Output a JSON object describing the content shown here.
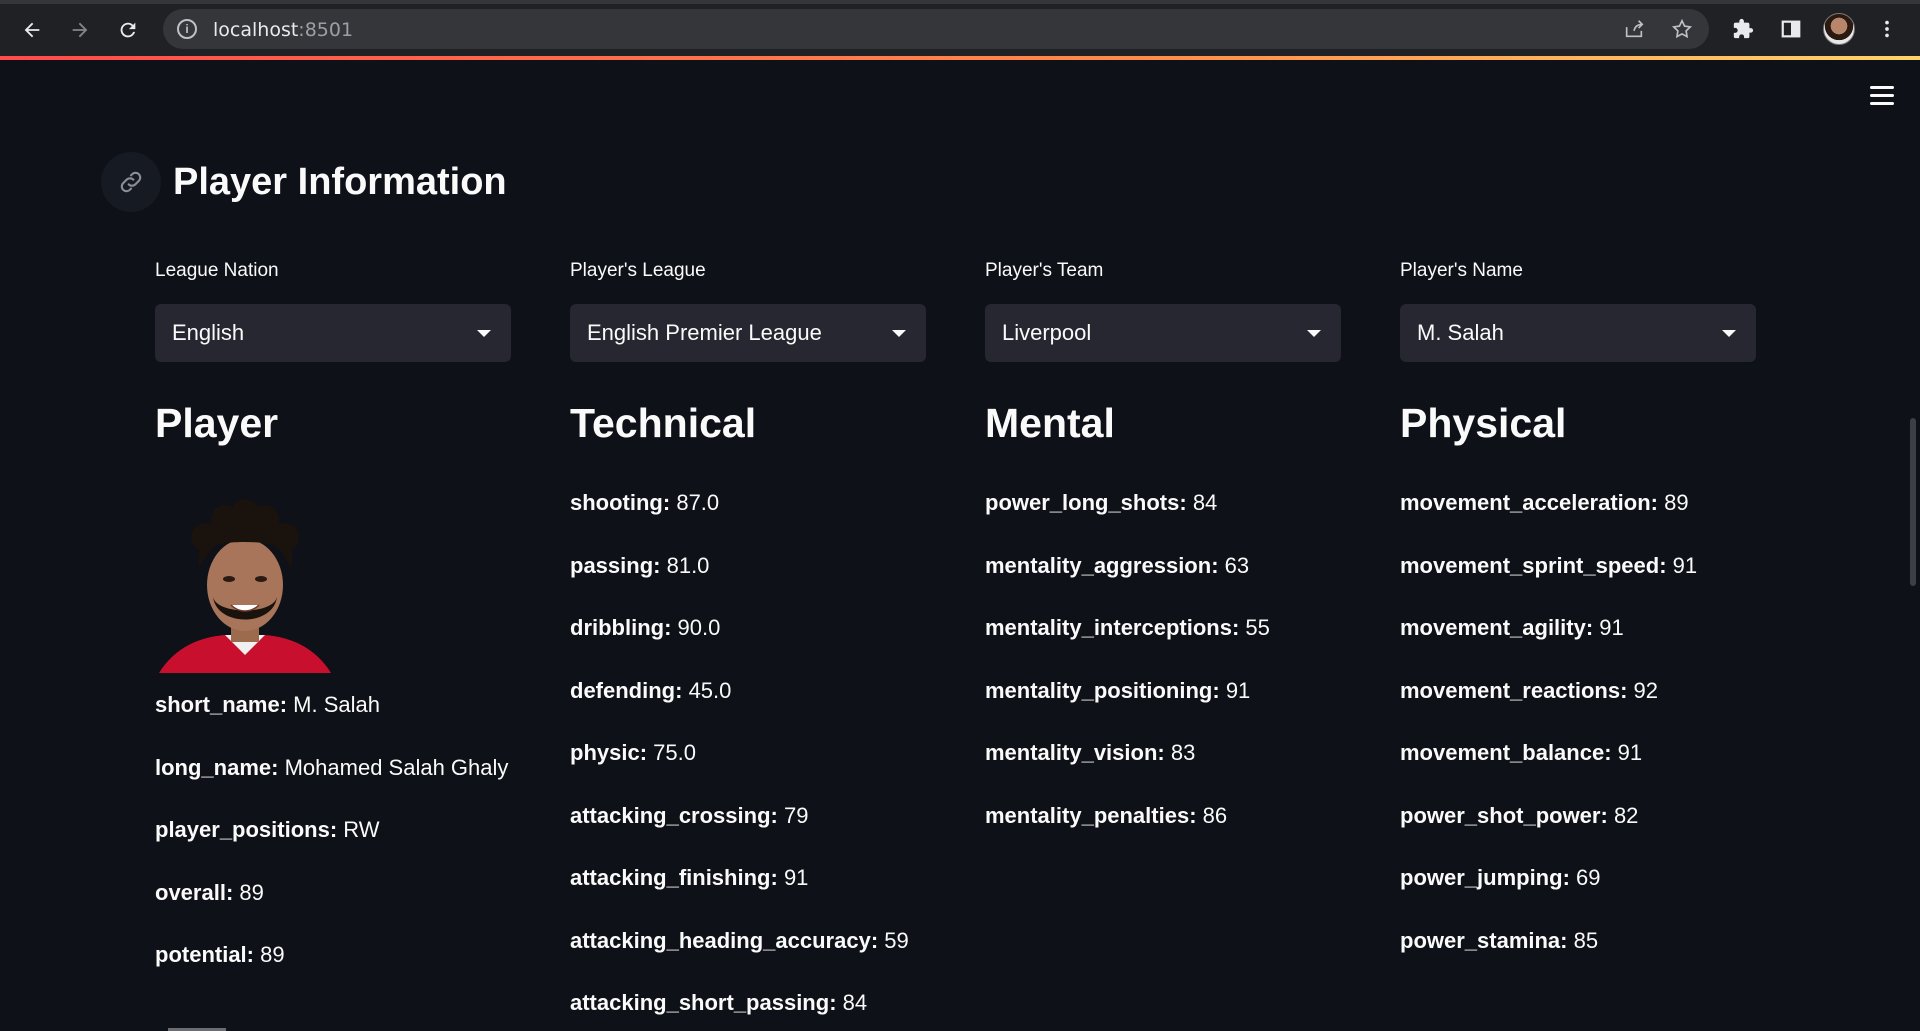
{
  "browser": {
    "url_host": "localhost",
    "url_port": ":8501",
    "icons": [
      "back-icon",
      "forward-icon",
      "reload-icon",
      "info-icon",
      "share-icon",
      "star-icon",
      "extensions-icon",
      "side-panel-icon",
      "profile-avatar",
      "more-vert-icon"
    ]
  },
  "page": {
    "title": "Player Information",
    "menu_icon": "hamburger-icon",
    "title_link_icon": "link-icon"
  },
  "filters": [
    {
      "label": "League Nation",
      "value": "English"
    },
    {
      "label": "Player's League",
      "value": "English Premier League"
    },
    {
      "label": "Player's Team",
      "value": "Liverpool"
    },
    {
      "label": "Player's Name",
      "value": "M. Salah"
    }
  ],
  "sections": {
    "player": {
      "heading": "Player",
      "stats": [
        {
          "key": "short_name",
          "value": "M. Salah"
        },
        {
          "key": "long_name",
          "value": "Mohamed Salah Ghaly"
        },
        {
          "key": "player_positions",
          "value": "RW"
        },
        {
          "key": "overall",
          "value": "89"
        },
        {
          "key": "potential",
          "value": "89"
        }
      ]
    },
    "technical": {
      "heading": "Technical",
      "stats": [
        {
          "key": "shooting",
          "value": "87.0"
        },
        {
          "key": "passing",
          "value": "81.0"
        },
        {
          "key": "dribbling",
          "value": "90.0"
        },
        {
          "key": "defending",
          "value": "45.0"
        },
        {
          "key": "physic",
          "value": "75.0"
        },
        {
          "key": "attacking_crossing",
          "value": "79"
        },
        {
          "key": "attacking_finishing",
          "value": "91"
        },
        {
          "key": "attacking_heading_accuracy",
          "value": "59"
        },
        {
          "key": "attacking_short_passing",
          "value": "84"
        }
      ]
    },
    "mental": {
      "heading": "Mental",
      "stats": [
        {
          "key": "power_long_shots",
          "value": "84"
        },
        {
          "key": "mentality_aggression",
          "value": "63"
        },
        {
          "key": "mentality_interceptions",
          "value": "55"
        },
        {
          "key": "mentality_positioning",
          "value": "91"
        },
        {
          "key": "mentality_vision",
          "value": "83"
        },
        {
          "key": "mentality_penalties",
          "value": "86"
        }
      ]
    },
    "physical": {
      "heading": "Physical",
      "stats": [
        {
          "key": "movement_acceleration",
          "value": "89"
        },
        {
          "key": "movement_sprint_speed",
          "value": "91"
        },
        {
          "key": "movement_agility",
          "value": "91"
        },
        {
          "key": "movement_reactions",
          "value": "92"
        },
        {
          "key": "movement_balance",
          "value": "91"
        },
        {
          "key": "power_shot_power",
          "value": "82"
        },
        {
          "key": "power_jumping",
          "value": "69"
        },
        {
          "key": "power_stamina",
          "value": "85"
        }
      ]
    }
  },
  "colors": {
    "background": "#0e1117",
    "select_bg": "#262730",
    "text": "#fafafa",
    "accent_start": "#ff4b4b",
    "accent_end": "#ffd36b"
  }
}
